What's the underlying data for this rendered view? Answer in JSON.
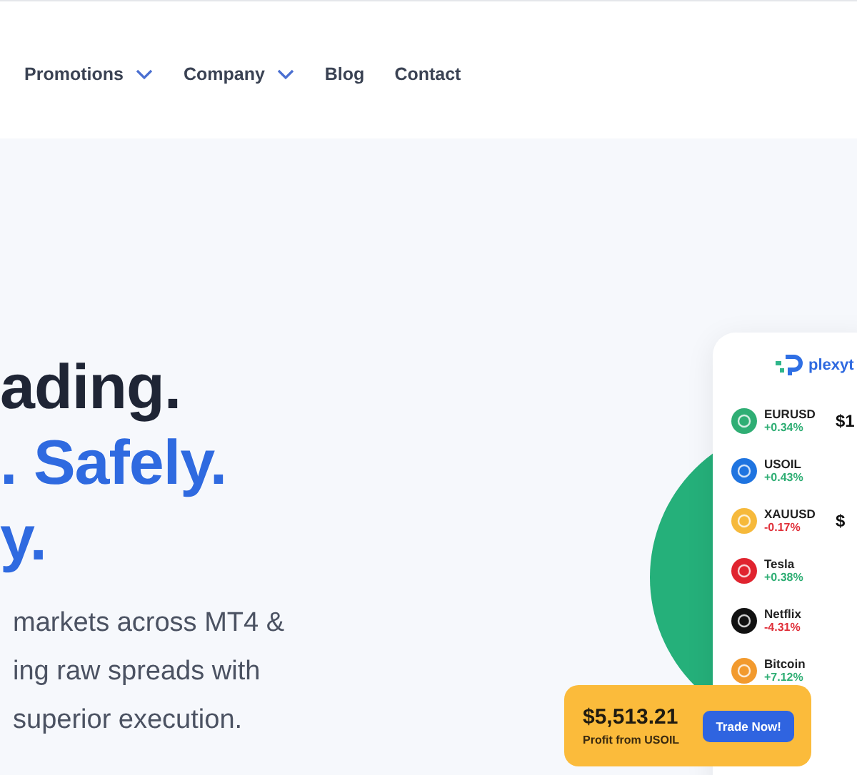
{
  "nav": [
    {
      "label": "Promotions",
      "has_menu": true
    },
    {
      "label": "Company",
      "has_menu": true
    },
    {
      "label": "Blog",
      "has_menu": false
    },
    {
      "label": "Contact",
      "has_menu": false
    }
  ],
  "hero": {
    "headline": [
      {
        "text": "ading.",
        "kind": "dark"
      },
      {
        "text": ". Safely.",
        "kind": "accent"
      },
      {
        "text": "y.",
        "kind": "accent"
      }
    ],
    "paragraph": [
      "markets across MT4 &",
      "ing raw spreads with",
      "superior execution."
    ]
  },
  "app_card": {
    "logo": "plexyt",
    "rows": [
      {
        "name": "EURUSD",
        "change": {
          "text": "+0.34%",
          "color": "#2fae74"
        },
        "color": "#2fae74",
        "price": "$1"
      },
      {
        "name": "USOIL",
        "change": {
          "text": "+0.43%",
          "color": "#2fae74"
        },
        "color": "#1f74e0",
        "price": ""
      },
      {
        "name": "XAUUSD",
        "change": {
          "text": "-0.17%",
          "color": "#e0303a"
        },
        "color": "#f6b93b",
        "price": "$"
      },
      {
        "name": "Tesla",
        "change": {
          "text": "+0.38%",
          "color": "#2fae74"
        },
        "color": "#e0242f",
        "price": ""
      },
      {
        "name": "Netflix",
        "change": {
          "text": "-4.31%",
          "color": "#e0303a"
        },
        "color": "#111111",
        "price": ""
      },
      {
        "name": "Bitcoin",
        "change": {
          "text": "+7.12%",
          "color": "#2fae74"
        },
        "color": "#f29a2e",
        "price": ""
      }
    ]
  },
  "promo": {
    "amount": "$5,513.21",
    "caption": "Profit from USOIL",
    "button": "Trade Now!"
  }
}
